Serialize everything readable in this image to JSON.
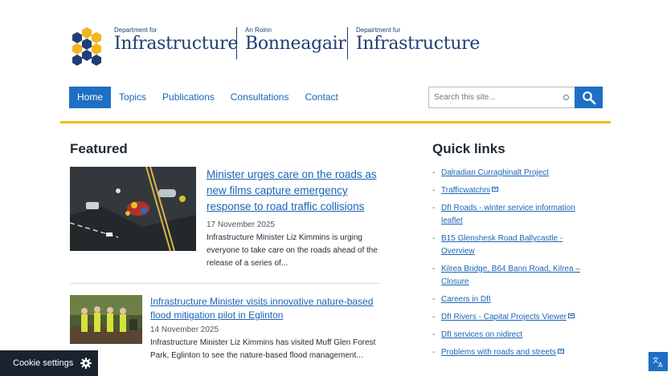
{
  "header": {
    "logos": [
      {
        "small": "Department for",
        "big": "Infrastructure"
      },
      {
        "small": "An Roinn",
        "big": "Bonneagair"
      },
      {
        "small": "Depairtment fur",
        "big": "Infrastructure"
      }
    ]
  },
  "nav": {
    "items": [
      "Home",
      "Topics",
      "Publications",
      "Consultations",
      "Contact"
    ],
    "active": "Home"
  },
  "search": {
    "placeholder": "Search this site..."
  },
  "featured": {
    "title": "Featured",
    "articles": [
      {
        "title": "Minister urges care on the roads as new films capture emergency response to road traffic collisions",
        "date": "17 November 2025",
        "summary": "Infrastructure Minister Liz Kimmins is urging everyone to take care on the roads ahead of the release of a series of..."
      },
      {
        "title": "Infrastructure Minister visits innovative nature-based flood mitigation pilot in Eglinton",
        "date": "14 November 2025",
        "summary": "Infrastructure Minister Liz Kimmins has visited Muff Glen Forest Park, Eglinton to see the nature-based flood management..."
      }
    ]
  },
  "quick_links": {
    "title": "Quick links",
    "items": [
      {
        "label": "Dalradian Curraghinalt Project",
        "external": false
      },
      {
        "label": "Trafficwatchni",
        "external": true
      },
      {
        "label": "DfI Roads - winter service information leaflet",
        "external": false
      },
      {
        "label": "B15 Glenshesk Road Ballycastle - Overview",
        "external": false
      },
      {
        "label": "Kilrea Bridge, B64 Bann Road, Kilrea – Closure",
        "external": false
      },
      {
        "label": "Careers in DfI",
        "external": false
      },
      {
        "label": "DfI Rivers - Capital Projects Viewer",
        "external": true
      },
      {
        "label": "DfI services on nidirect",
        "external": false
      },
      {
        "label": "Problems with roads and streets",
        "external": true
      }
    ]
  },
  "cookie": {
    "label": "Cookie settings",
    "icon": "gear-icon"
  },
  "translate": {
    "icon": "translate-icon"
  },
  "colors": {
    "accent": "#1e6fc4",
    "link": "#1a64b6",
    "rule": "#f3bb1b",
    "cookie_bg": "#1b2330"
  }
}
